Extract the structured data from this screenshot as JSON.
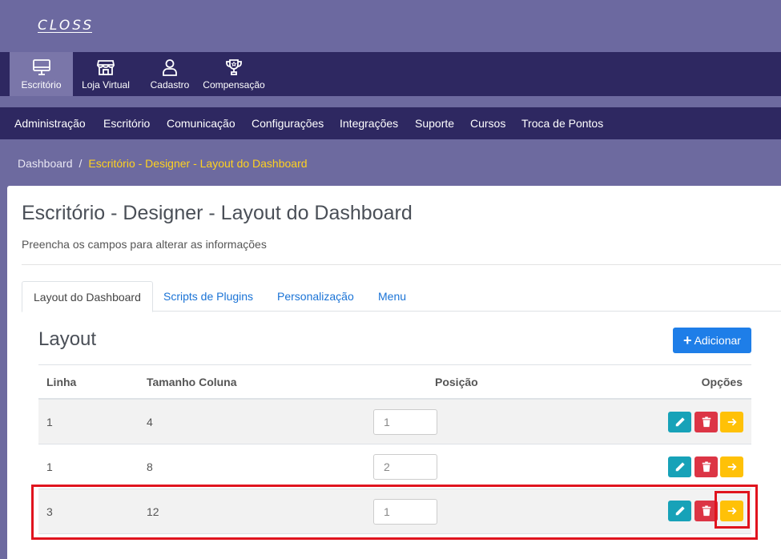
{
  "brand": {
    "logo_text": "CLOSS"
  },
  "modules": [
    {
      "label": "Escritório",
      "icon": "monitor-icon",
      "active": true
    },
    {
      "label": "Loja Virtual",
      "icon": "store-icon",
      "active": false
    },
    {
      "label": "Cadastro",
      "icon": "user-icon",
      "active": false
    },
    {
      "label": "Compensação",
      "icon": "trophy-icon",
      "active": false
    }
  ],
  "menu": [
    "Administração",
    "Escritório",
    "Comunicação",
    "Configurações",
    "Integrações",
    "Suporte",
    "Cursos",
    "Troca de Pontos"
  ],
  "breadcrumb": {
    "root": "Dashboard",
    "separator": "/",
    "current": "Escritório - Designer - Layout do Dashboard"
  },
  "page": {
    "title": "Escritório - Designer - Layout do Dashboard",
    "subtitle": "Preencha os campos para alterar as informações"
  },
  "tabs": [
    "Layout do Dashboard",
    "Scripts de Plugins",
    "Personalização",
    "Menu"
  ],
  "layout": {
    "title": "Layout",
    "add_label": "Adicionar",
    "columns": [
      "Linha",
      "Tamanho Coluna",
      "Posição",
      "Opções"
    ],
    "rows": [
      {
        "linha": "1",
        "tamanho": "4",
        "posicao": "1"
      },
      {
        "linha": "1",
        "tamanho": "8",
        "posicao": "2"
      },
      {
        "linha": "3",
        "tamanho": "12",
        "posicao": "1"
      }
    ]
  },
  "colors": {
    "accent": "#1e7ee8",
    "nav": "#2e2861",
    "header": "#6c69a0",
    "highlight": "#e0141e",
    "breadcrumb_current": "#ffd21f"
  }
}
